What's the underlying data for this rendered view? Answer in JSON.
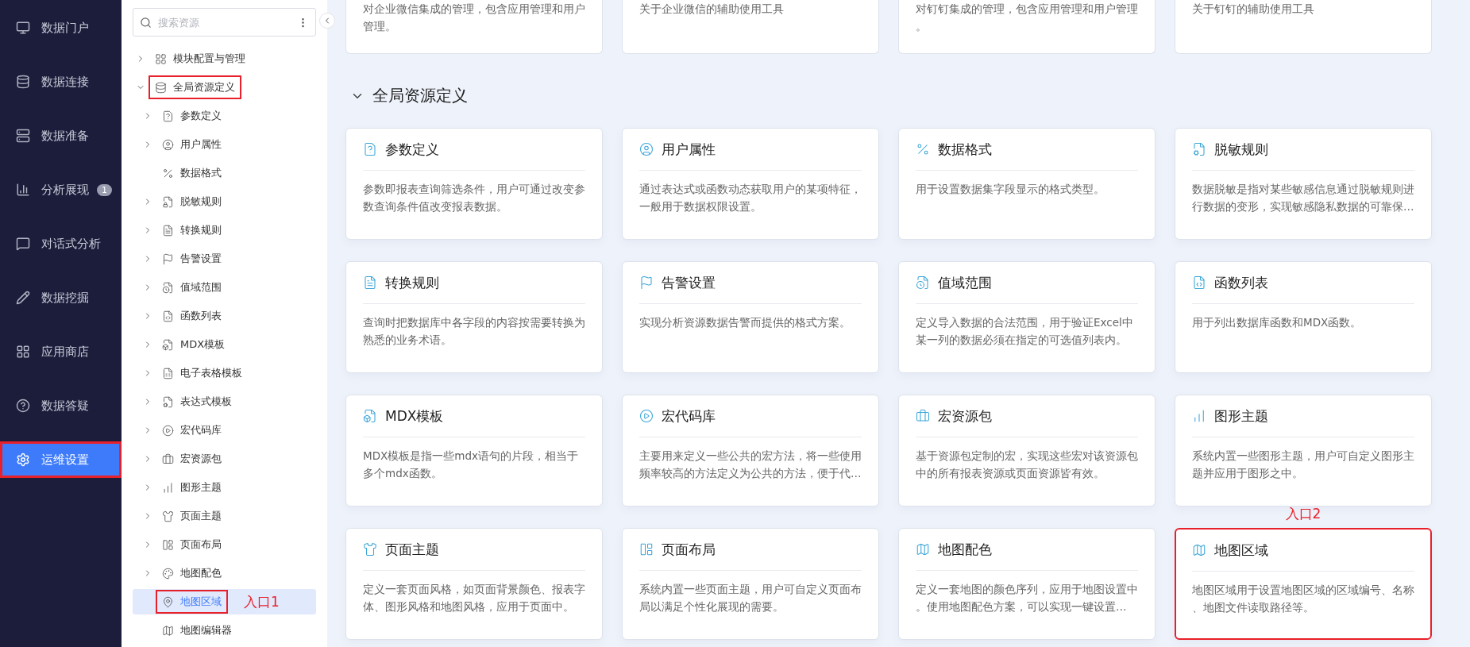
{
  "nav": {
    "items": [
      {
        "label": "数据门户",
        "selected": false,
        "highlighted": false
      },
      {
        "label": "数据连接",
        "selected": false,
        "highlighted": false
      },
      {
        "label": "数据准备",
        "selected": false,
        "highlighted": false
      },
      {
        "label": "分析展现",
        "selected": false,
        "highlighted": false,
        "badge": "1"
      },
      {
        "label": "对话式分析",
        "selected": false,
        "highlighted": false
      },
      {
        "label": "数据挖掘",
        "selected": false,
        "highlighted": false
      },
      {
        "label": "应用商店",
        "selected": false,
        "highlighted": false
      },
      {
        "label": "数据答疑",
        "selected": false,
        "highlighted": false
      },
      {
        "label": "运维设置",
        "selected": true,
        "highlighted": true
      }
    ]
  },
  "resource_tree": {
    "search": {
      "placeholder": "搜索资源"
    },
    "items": [
      {
        "label": "模块配置与管理",
        "expandable": true,
        "expanded": false,
        "selected": false,
        "highlighted": false
      },
      {
        "label": "全局资源定义",
        "expandable": true,
        "expanded": true,
        "selected": false,
        "highlighted": true,
        "children": [
          {
            "label": "参数定义",
            "expandable": true,
            "selected": false,
            "highlighted": false
          },
          {
            "label": "用户属性",
            "expandable": true,
            "selected": false,
            "highlighted": false
          },
          {
            "label": "数据格式",
            "expandable": false,
            "selected": false,
            "highlighted": false
          },
          {
            "label": "脱敏规则",
            "expandable": true,
            "selected": false,
            "highlighted": false
          },
          {
            "label": "转换规则",
            "expandable": true,
            "selected": false,
            "highlighted": false
          },
          {
            "label": "告警设置",
            "expandable": true,
            "selected": false,
            "highlighted": false
          },
          {
            "label": "值域范围",
            "expandable": true,
            "selected": false,
            "highlighted": false
          },
          {
            "label": "函数列表",
            "expandable": true,
            "selected": false,
            "highlighted": false
          },
          {
            "label": "MDX模板",
            "expandable": true,
            "selected": false,
            "highlighted": false
          },
          {
            "label": "电子表格模板",
            "expandable": true,
            "selected": false,
            "highlighted": false
          },
          {
            "label": "表达式模板",
            "expandable": true,
            "selected": false,
            "highlighted": false
          },
          {
            "label": "宏代码库",
            "expandable": true,
            "selected": false,
            "highlighted": false
          },
          {
            "label": "宏资源包",
            "expandable": true,
            "selected": false,
            "highlighted": false
          },
          {
            "label": "图形主题",
            "expandable": true,
            "selected": false,
            "highlighted": false
          },
          {
            "label": "页面主题",
            "expandable": true,
            "selected": false,
            "highlighted": false
          },
          {
            "label": "页面布局",
            "expandable": true,
            "selected": false,
            "highlighted": false
          },
          {
            "label": "地图配色",
            "expandable": true,
            "selected": false,
            "highlighted": false
          },
          {
            "label": "地图区域",
            "expandable": false,
            "selected": true,
            "highlighted": true,
            "annotation": "入口1"
          },
          {
            "label": "地图编辑器",
            "expandable": false,
            "selected": false,
            "highlighted": false
          }
        ]
      }
    ]
  },
  "top_cards": [
    {
      "description": "对企业微信集成的管理，包含应用管理和用户管理。"
    },
    {
      "description": "关于企业微信的辅助使用工具"
    },
    {
      "description": "对钉钉集成的管理，包含应用管理和用户管理。"
    },
    {
      "description": "关于钉钉的辅助使用工具"
    }
  ],
  "section": {
    "title": "全局资源定义",
    "expanded": true,
    "cards": [
      {
        "title": "参数定义",
        "description": "参数即报表查询筛选条件，用户可通过改变参数查询条件值改变报表数据。",
        "highlighted": false
      },
      {
        "title": "用户属性",
        "description": "通过表达式或函数动态获取用户的某项特征，一般用于数据权限设置。",
        "highlighted": false
      },
      {
        "title": "数据格式",
        "description": "用于设置数据集字段显示的格式类型。",
        "highlighted": false
      },
      {
        "title": "脱敏规则",
        "description": "数据脱敏是指对某些敏感信息通过脱敏规则进行数据的变形，实现敏感隐私数据的可靠保…",
        "highlighted": false
      },
      {
        "title": "转换规则",
        "description": "查询时把数据库中各字段的内容按需要转换为熟悉的业务术语。",
        "highlighted": false
      },
      {
        "title": "告警设置",
        "description": "实现分析资源数据告警而提供的格式方案。",
        "highlighted": false
      },
      {
        "title": "值域范围",
        "description": "定义导入数据的合法范围，用于验证Excel中某一列的数据必须在指定的可选值列表内。",
        "highlighted": false
      },
      {
        "title": "函数列表",
        "description": "用于列出数据库函数和MDX函数。",
        "highlighted": false
      },
      {
        "title": "MDX模板",
        "description": "MDX模板是指一些mdx语句的片段，相当于多个mdx函数。",
        "highlighted": false
      },
      {
        "title": "宏代码库",
        "description": "主要用来定义一些公共的宏方法，将一些使用频率较高的方法定义为公共的方法，便于代…",
        "highlighted": false
      },
      {
        "title": "宏资源包",
        "description": "基于资源包定制的宏，实现这些宏对该资源包中的所有报表资源或页面资源皆有效。",
        "highlighted": false
      },
      {
        "title": "图形主题",
        "description": "系统内置一些图形主题，用户可自定义图形主题并应用于图形之中。",
        "highlighted": false
      },
      {
        "title": "页面主题",
        "description": "定义一套页面风格，如页面背景颜色、报表字体、图形风格和地图风格，应用于页面中。",
        "highlighted": false
      },
      {
        "title": "页面布局",
        "description": "系统内置一些页面主题，用户可自定义页面布局以满足个性化展现的需要。",
        "highlighted": false
      },
      {
        "title": "地图配色",
        "description": "定义一套地图的颜色序列，应用于地图设置中。使用地图配色方案，可以实现一键设置…",
        "highlighted": false
      },
      {
        "title": "地图区域",
        "description": "地图区域用于设置地图区域的区域编号、名称、地图文件读取路径等。",
        "highlighted": true
      }
    ]
  },
  "card_annotation": {
    "text": "入口2"
  }
}
